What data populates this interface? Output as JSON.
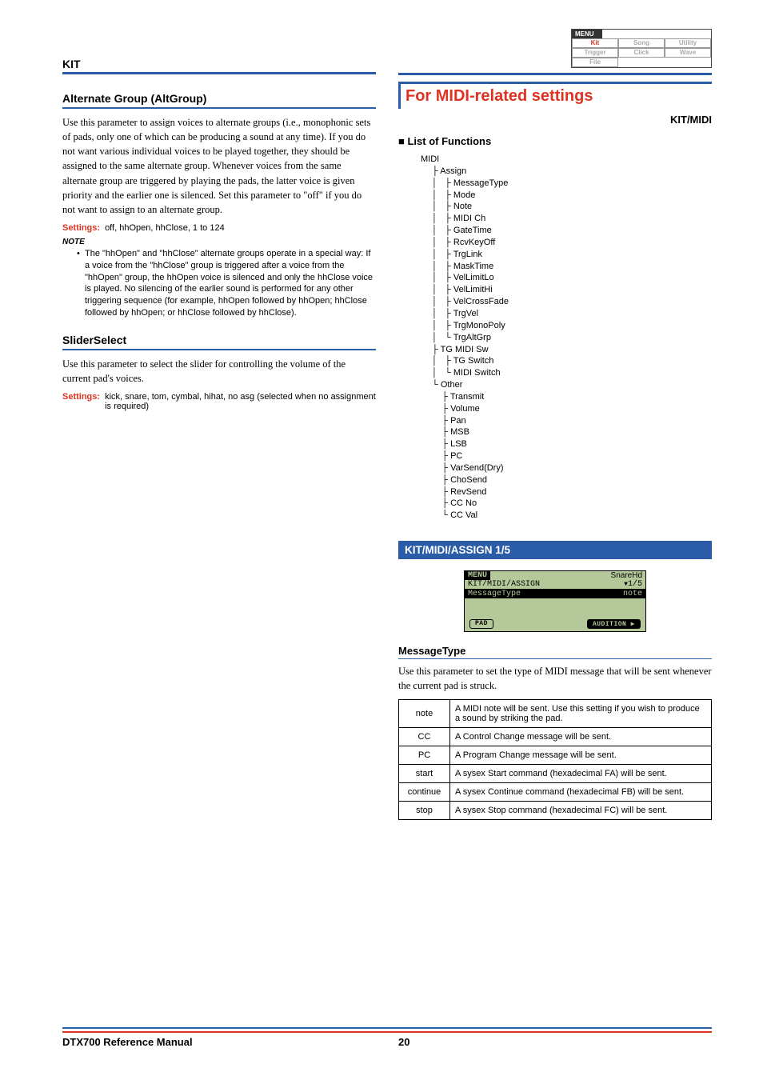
{
  "menu": {
    "tab": "MENU",
    "cells": [
      "Kit",
      "Song",
      "Utility",
      "Trigger",
      "Click",
      "Wave",
      "File",
      "",
      ""
    ]
  },
  "left": {
    "kit": "KIT",
    "altgroup": {
      "heading": "Alternate Group (AltGroup)",
      "body": "Use this parameter to assign voices to alternate groups (i.e., monophonic sets of pads, only one of which can be producing a sound at any time). If you do not want various individual voices to be played together, they should be assigned to the same alternate group. Whenever voices from the same alternate group are triggered by playing the pads, the latter voice is given priority and the earlier one is silenced. Set this parameter to \"off\" if you do not want to assign to an alternate group.",
      "settings_label": "Settings:",
      "settings_value": "off, hhOpen, hhClose, 1 to 124",
      "note_label": "NOTE",
      "note_body": "The \"hhOpen\" and \"hhClose\" alternate groups operate in a special way: If a voice from the \"hhClose\" group is triggered after a voice from the \"hhOpen\" group, the hhOpen voice is silenced and only the hhClose voice is played. No silencing of the earlier sound is performed for any other triggering sequence (for example, hhOpen followed by hhOpen; hhClose followed by hhOpen; or hhClose followed by hhClose)."
    },
    "slider": {
      "heading": "SliderSelect",
      "body": "Use this parameter to select the slider for controlling the volume of the current pad's voices.",
      "settings_label": "Settings:",
      "settings_value": "kick, snare, tom, cymbal, hihat, no asg (selected when no assignment is required)"
    }
  },
  "right": {
    "for_midi": "For MIDI-related settings",
    "kitmidi": "KIT/MIDI",
    "list_functions": "List of Functions",
    "tree": {
      "root": "MIDI",
      "groups": [
        {
          "name": "Assign",
          "items": [
            "MessageType",
            "Mode",
            "Note",
            "MIDI Ch",
            "GateTime",
            "RcvKeyOff",
            "TrgLink",
            "MaskTime",
            "VelLimitLo",
            "VelLimitHi",
            "VelCrossFade",
            "TrgVel",
            "TrgMonoPoly",
            "TrgAltGrp"
          ]
        },
        {
          "name": "TG MIDI Sw",
          "items": [
            "TG Switch",
            "MIDI Switch"
          ]
        },
        {
          "name": "Other",
          "items": [
            "Transmit",
            "Volume",
            "Pan",
            "MSB",
            "LSB",
            "PC",
            "VarSend(Dry)",
            "ChoSend",
            "RevSend",
            "CC No",
            "CC Val"
          ]
        }
      ]
    },
    "band": "KIT/MIDI/ASSIGN  1/5",
    "lcd": {
      "menu": "MENU",
      "top_right": "SnareHd",
      "line2_left": "KIT/MIDI/ASSIGN",
      "line2_right": "1/5",
      "line3_left": "MessageType",
      "line3_right": "note",
      "btn_left": "PAD",
      "btn_right": "AUDITION"
    },
    "msgtype": {
      "heading": "MessageType",
      "body": "Use this parameter to set the type of MIDI message that will be sent whenever the current pad is struck.",
      "rows": [
        {
          "k": "note",
          "v": "A MIDI note will be sent. Use this setting if you wish to produce a sound by striking the pad."
        },
        {
          "k": "CC",
          "v": "A Control Change message will be sent."
        },
        {
          "k": "PC",
          "v": "A Program Change message will be sent."
        },
        {
          "k": "start",
          "v": "A sysex Start command (hexadecimal FA) will be sent."
        },
        {
          "k": "continue",
          "v": "A sysex Continue command (hexadecimal FB) will be sent."
        },
        {
          "k": "stop",
          "v": "A sysex Stop command (hexadecimal FC) will be sent."
        }
      ]
    }
  },
  "footer": {
    "left": "DTX700  Reference Manual",
    "page": "20"
  }
}
